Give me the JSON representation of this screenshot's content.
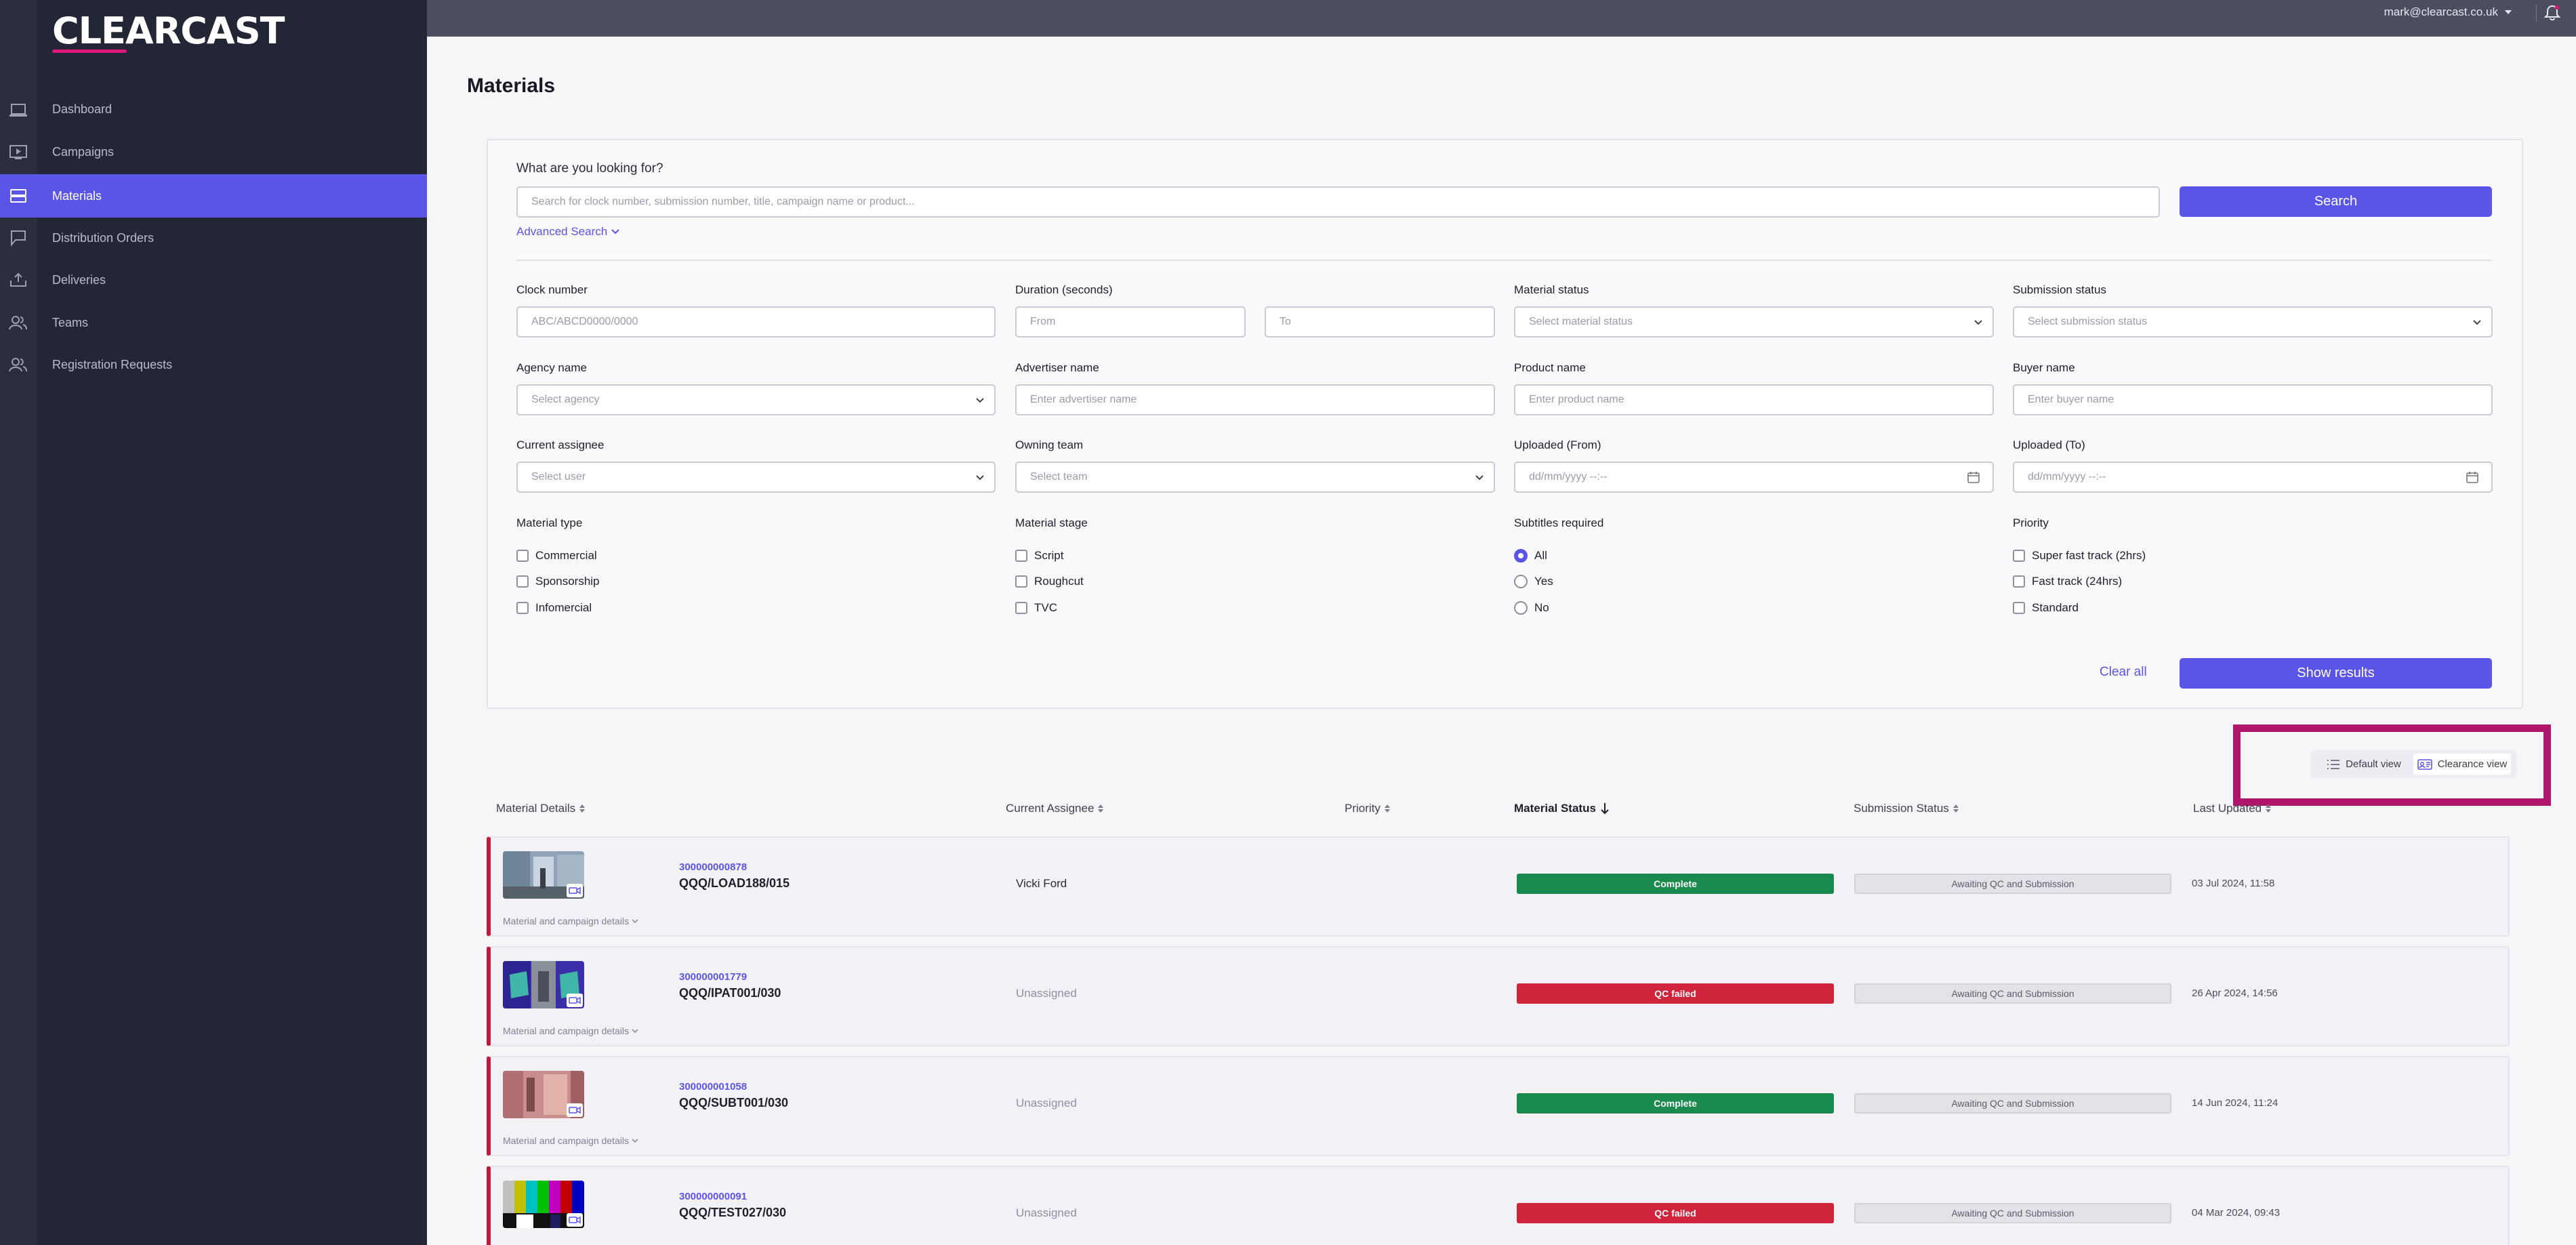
{
  "brand": {
    "logo_text": "CLEARCAST",
    "accent": "#e0177a",
    "primary": "#5a55e6"
  },
  "topbar": {
    "user_email": "mark@clearcast.co.uk"
  },
  "sidebar": {
    "items": [
      {
        "label": "Dashboard",
        "icon": "laptop-icon"
      },
      {
        "label": "Campaigns",
        "icon": "play-screen-icon"
      },
      {
        "label": "Materials",
        "icon": "stack-icon",
        "active": true
      },
      {
        "label": "Distribution Orders",
        "icon": "flag-icon"
      },
      {
        "label": "Deliveries",
        "icon": "upload-tray-icon"
      },
      {
        "label": "Teams",
        "icon": "people-icon"
      },
      {
        "label": "Registration Requests",
        "icon": "people-icon"
      }
    ]
  },
  "page": {
    "title": "Materials"
  },
  "search": {
    "question": "What are you looking for?",
    "placeholder": "Search for clock number, submission number, title, campaign name or product...",
    "button": "Search",
    "advanced": "Advanced Search"
  },
  "filters": {
    "clock_number": {
      "label": "Clock number",
      "placeholder": "ABC/ABCD0000/0000"
    },
    "duration": {
      "label": "Duration (seconds)",
      "from": "From",
      "to": "To"
    },
    "material_status": {
      "label": "Material status",
      "placeholder": "Select material status"
    },
    "submission_status": {
      "label": "Submission status",
      "placeholder": "Select submission status"
    },
    "agency": {
      "label": "Agency name",
      "placeholder": "Select agency"
    },
    "advertiser": {
      "label": "Advertiser name",
      "placeholder": "Enter advertiser name"
    },
    "product": {
      "label": "Product name",
      "placeholder": "Enter product name"
    },
    "buyer": {
      "label": "Buyer name",
      "placeholder": "Enter buyer name"
    },
    "assignee": {
      "label": "Current assignee",
      "placeholder": "Select user"
    },
    "team": {
      "label": "Owning team",
      "placeholder": "Select team"
    },
    "uploaded_from": {
      "label": "Uploaded (From)",
      "placeholder": "dd/mm/yyyy --:--"
    },
    "uploaded_to": {
      "label": "Uploaded (To)",
      "placeholder": "dd/mm/yyyy --:--"
    },
    "material_type": {
      "label": "Material type",
      "options": [
        "Commercial",
        "Sponsorship",
        "Infomercial"
      ]
    },
    "material_stage": {
      "label": "Material stage",
      "options": [
        "Script",
        "Roughcut",
        "TVC"
      ]
    },
    "subtitles": {
      "label": "Subtitles required",
      "options": [
        "All",
        "Yes",
        "No"
      ],
      "selected": "All"
    },
    "priority": {
      "label": "Priority",
      "options": [
        "Super fast track (2hrs)",
        "Fast track (24hrs)",
        "Standard"
      ]
    },
    "clear_all": "Clear all",
    "show_results": "Show results"
  },
  "views": {
    "default": "Default view",
    "clearance": "Clearance view",
    "selected": "Clearance view"
  },
  "table": {
    "columns": [
      "Material Details",
      "Current Assignee",
      "Priority",
      "Material Status",
      "Submission Status",
      "Last Updated"
    ],
    "details_link": "Material and campaign details",
    "rows": [
      {
        "clock": "300000000878",
        "ref": "QQQ/LOAD188/015",
        "assignee": "Vicki Ford",
        "material_status": "Complete",
        "status_color": "#1b8a4e",
        "submission_status": "Awaiting QC and Submission",
        "updated": "03 Jul 2024, 11:58",
        "thumb": "office"
      },
      {
        "clock": "300000001779",
        "ref": "QQQ/IPAT001/030",
        "assignee": "Unassigned",
        "material_status": "QC failed",
        "status_color": "#d0233c",
        "submission_status": "Awaiting QC and Submission",
        "updated": "26 Apr 2024, 14:56",
        "thumb": "purple"
      },
      {
        "clock": "300000001058",
        "ref": "QQQ/SUBT001/030",
        "assignee": "Unassigned",
        "material_status": "Complete",
        "status_color": "#1b8a4e",
        "submission_status": "Awaiting QC and Submission",
        "updated": "14 Jun 2024, 11:24",
        "thumb": "pink"
      },
      {
        "clock": "300000000091",
        "ref": "QQQ/TEST027/030",
        "assignee": "Unassigned",
        "material_status": "QC failed",
        "status_color": "#d0233c",
        "submission_status": "Awaiting QC and Submission",
        "updated": "04 Mar 2024, 09:43",
        "thumb": "colorbars"
      }
    ]
  }
}
